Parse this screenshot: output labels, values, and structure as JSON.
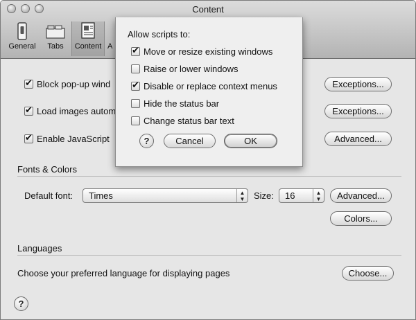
{
  "window": {
    "title": "Content"
  },
  "toolbar": {
    "items": [
      {
        "label": "General",
        "icon": "general-switch-icon"
      },
      {
        "label": "Tabs",
        "icon": "tabs-icon"
      },
      {
        "label": "Content",
        "icon": "content-document-icon",
        "selected": true
      },
      {
        "label": "A",
        "icon": "partially-hidden-icon"
      }
    ]
  },
  "content": {
    "block_popups": {
      "label": "Block pop-up wind",
      "checked": true
    },
    "load_images": {
      "label": "Load images autom",
      "checked": true
    },
    "enable_js": {
      "label": "Enable JavaScript",
      "checked": true
    },
    "exceptions_label_1": "Exceptions...",
    "exceptions_label_2": "Exceptions...",
    "advanced_js_label": "Advanced...",
    "fonts_section": "Fonts & Colors",
    "default_font_label": "Default font:",
    "default_font_value": "Times",
    "size_label": "Size:",
    "size_value": "16",
    "advanced_fonts_label": "Advanced...",
    "colors_label": "Colors...",
    "languages_section": "Languages",
    "languages_text": "Choose your preferred language for displaying pages",
    "choose_label": "Choose...",
    "help_label": "?"
  },
  "sheet": {
    "heading": "Allow scripts to:",
    "options": [
      {
        "label": "Move or resize existing windows",
        "checked": true
      },
      {
        "label": "Raise or lower windows",
        "checked": false
      },
      {
        "label": "Disable or replace context menus",
        "checked": true
      },
      {
        "label": "Hide the status bar",
        "checked": false
      },
      {
        "label": "Change status bar text",
        "checked": false
      }
    ],
    "help_label": "?",
    "cancel_label": "Cancel",
    "ok_label": "OK"
  },
  "colors": {
    "window_bg": "#e6e6e6",
    "sheet_bg": "#efefef"
  }
}
